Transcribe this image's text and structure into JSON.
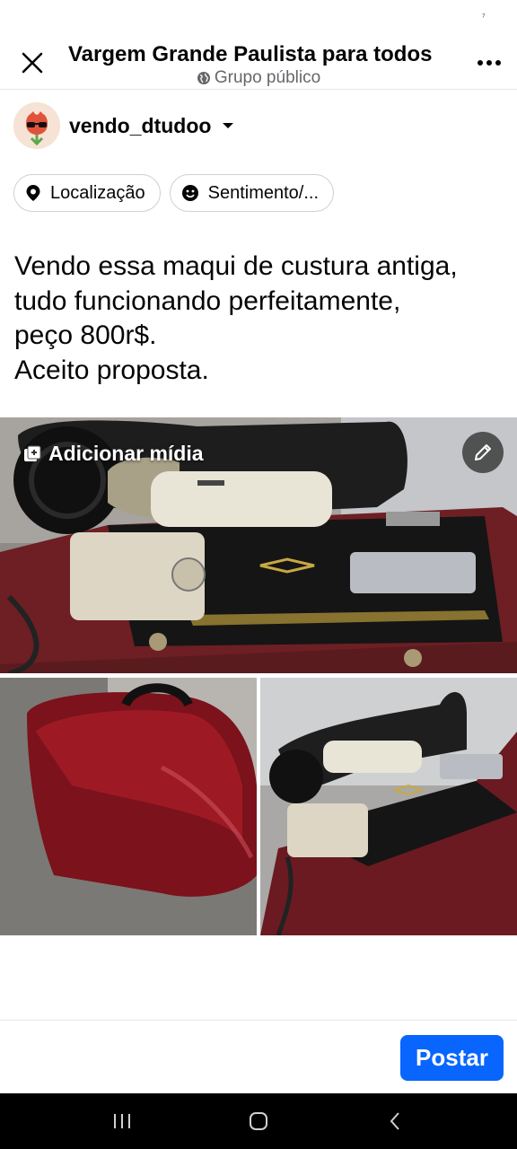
{
  "status": {
    "mark": "⁷"
  },
  "header": {
    "title": "Vargem Grande Paulista para todos",
    "subtitle": "Grupo público"
  },
  "author": {
    "name": "vendo_dtudoo"
  },
  "chips": [
    {
      "label": "Localização",
      "icon": "location-pin-icon"
    },
    {
      "label": "Sentimento/...",
      "icon": "smiley-icon"
    }
  ],
  "post": {
    "lines": [
      "Vendo essa maqui de custura antiga,",
      "tudo funcionando perfeitamente,",
      "peço 800r$.",
      "Aceito proposta."
    ]
  },
  "media": {
    "add_label": "Adicionar mídia",
    "photos": [
      "sewing-machine-photo",
      "red-case-photo",
      "sewing-machine-photo-2"
    ]
  },
  "footer": {
    "post_label": "Postar"
  },
  "colors": {
    "accent": "#0866ff",
    "text": "#050505",
    "muted": "#65676b"
  }
}
